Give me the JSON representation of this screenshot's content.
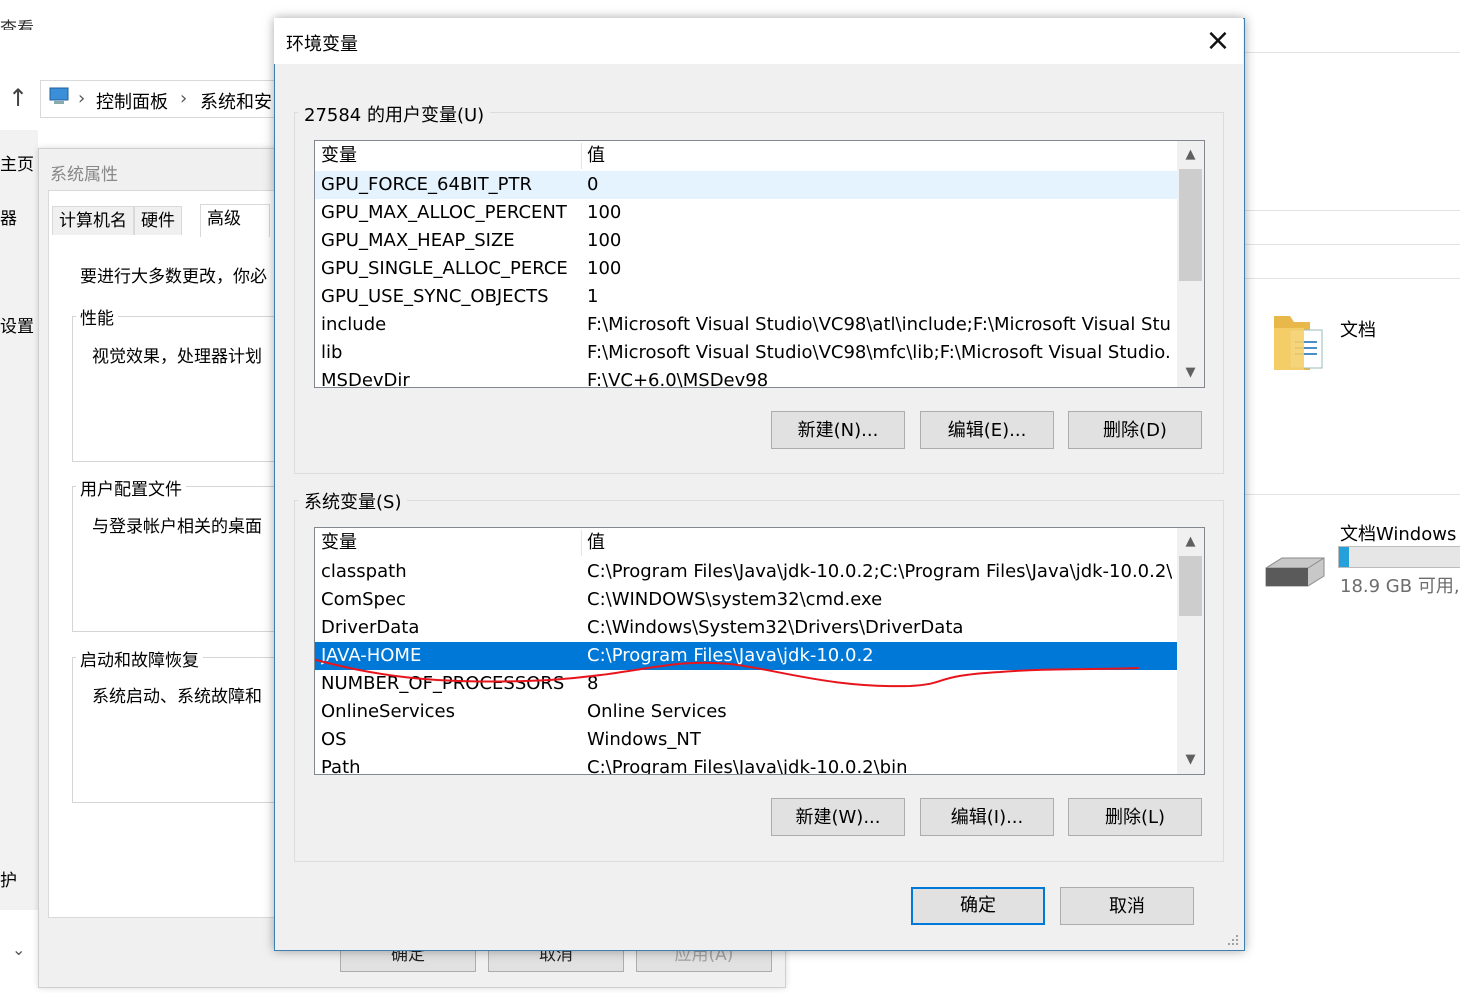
{
  "explorer": {
    "top_left_clip": "查看",
    "breadcrumb": [
      "控制面板",
      "系统和安"
    ],
    "left_nav": [
      "主页",
      "器",
      "设置",
      "护"
    ],
    "right_items": {
      "documents_label": "文档",
      "drive_label": "文档Windows",
      "drive_free": "18.9 GB 可用,",
      "drive_used_fraction": 0.08
    }
  },
  "system_properties": {
    "title": "系统属性",
    "tabs": [
      "计算机名",
      "硬件",
      "高级"
    ],
    "active_tab": "高级",
    "intro": "要进行大多数更改，你必",
    "groups": [
      {
        "title": "性能",
        "text": "视觉效果，处理器计划"
      },
      {
        "title": "用户配置文件",
        "text": "与登录帐户相关的桌面"
      },
      {
        "title": "启动和故障恢复",
        "text": "系统启动、系统故障和"
      }
    ],
    "buttons": [
      "确定",
      "取消",
      "应用(A)"
    ]
  },
  "env_dialog": {
    "title": "环境变量",
    "user_section": {
      "title": "27584 的用户变量(U)",
      "col_name": "变量",
      "col_value": "值",
      "rows": [
        {
          "name": "GPU_FORCE_64BIT_PTR",
          "value": "0"
        },
        {
          "name": "GPU_MAX_ALLOC_PERCENT",
          "value": "100"
        },
        {
          "name": "GPU_MAX_HEAP_SIZE",
          "value": "100"
        },
        {
          "name": "GPU_SINGLE_ALLOC_PERCE",
          "value": "100"
        },
        {
          "name": "GPU_USE_SYNC_OBJECTS",
          "value": "1"
        },
        {
          "name": "include",
          "value": "F:\\Microsoft Visual Studio\\VC98\\atl\\include;F:\\Microsoft Visual Stu..."
        },
        {
          "name": "lib",
          "value": "F:\\Microsoft Visual Studio\\VC98\\mfc\\lib;F:\\Microsoft Visual Studio..."
        },
        {
          "name": "MSDevDir",
          "value": "F:\\VC+6.0\\MSDev98"
        }
      ],
      "hovered_row": 0,
      "buttons": {
        "new": "新建(N)...",
        "edit": "编辑(E)...",
        "delete": "删除(D)"
      }
    },
    "system_section": {
      "title": "系统变量(S)",
      "col_name": "变量",
      "col_value": "值",
      "rows": [
        {
          "name": "classpath",
          "value": "C:\\Program Files\\Java\\jdk-10.0.2;C:\\Program Files\\Java\\jdk-10.0.2\\"
        },
        {
          "name": "ComSpec",
          "value": "C:\\WINDOWS\\system32\\cmd.exe"
        },
        {
          "name": "DriverData",
          "value": "C:\\Windows\\System32\\Drivers\\DriverData"
        },
        {
          "name": "JAVA-HOME",
          "value": "C:\\Program Files\\Java\\jdk-10.0.2"
        },
        {
          "name": "NUMBER_OF_PROCESSORS",
          "value": "8"
        },
        {
          "name": "OnlineServices",
          "value": "Online Services"
        },
        {
          "name": "OS",
          "value": "Windows_NT"
        },
        {
          "name": "Path",
          "value": "C:\\Program Files\\Java\\jdk-10.0.2\\bin"
        }
      ],
      "selected_row": 3,
      "buttons": {
        "new": "新建(W)...",
        "edit": "编辑(I)...",
        "delete": "删除(L)"
      }
    },
    "ok": "确定",
    "cancel": "取消"
  },
  "annotation_color": "#e8141c",
  "colors": {
    "selection": "#0078d7",
    "hover": "#e5f3ff",
    "dialog_bg": "#f0f0f0"
  }
}
